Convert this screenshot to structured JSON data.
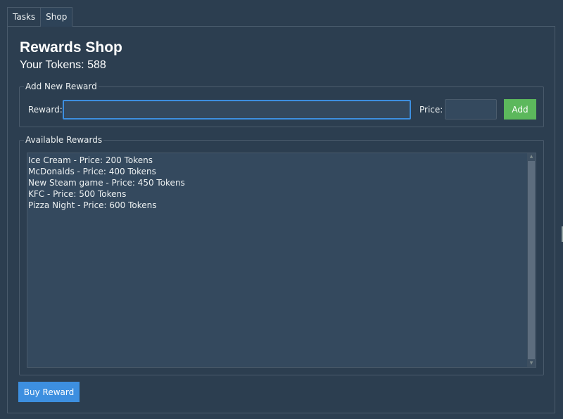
{
  "tabs": [
    {
      "label": "Tasks",
      "active": false
    },
    {
      "label": "Shop",
      "active": true
    }
  ],
  "shop": {
    "title": "Rewards Shop",
    "tokens_text": "Your Tokens: 588"
  },
  "add_reward": {
    "group_title": "Add New Reward",
    "reward_label": "Reward:",
    "reward_value": "",
    "price_label": "Price:",
    "price_value": "",
    "add_button": "Add"
  },
  "available": {
    "group_title": "Available Rewards",
    "items": [
      "Ice Cream - Price: 200 Tokens",
      "McDonalds - Price: 400 Tokens",
      "New Steam game - Price: 450 Tokens",
      "KFC - Price: 500 Tokens",
      "Pizza Night - Price: 600 Tokens"
    ]
  },
  "buy_button": "Buy Reward",
  "colors": {
    "background": "#2c3e50",
    "field": "#34495e",
    "accent_blue": "#3d8fe0",
    "accent_green": "#5cb85c"
  }
}
